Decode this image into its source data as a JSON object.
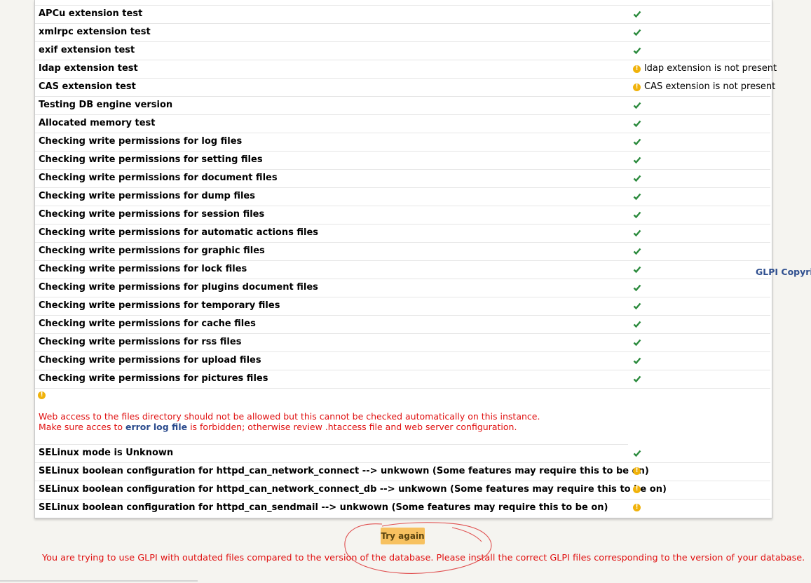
{
  "checks": [
    {
      "label": "APCu extension test",
      "status": "ok"
    },
    {
      "label": "xmlrpc extension test",
      "status": "ok"
    },
    {
      "label": "exif extension test",
      "status": "ok"
    },
    {
      "label": "ldap extension test",
      "status": "warning",
      "message": "ldap extension is not present"
    },
    {
      "label": "CAS extension test",
      "status": "warning",
      "message": "CAS extension is not present"
    },
    {
      "label": "Testing DB engine version",
      "status": "ok"
    },
    {
      "label": "Allocated memory test",
      "status": "ok"
    },
    {
      "label": "Checking write permissions for log files",
      "status": "ok"
    },
    {
      "label": "Checking write permissions for setting files",
      "status": "ok"
    },
    {
      "label": "Checking write permissions for document files",
      "status": "ok"
    },
    {
      "label": "Checking write permissions for dump files",
      "status": "ok"
    },
    {
      "label": "Checking write permissions for session files",
      "status": "ok"
    },
    {
      "label": "Checking write permissions for automatic actions files",
      "status": "ok"
    },
    {
      "label": "Checking write permissions for graphic files",
      "status": "ok"
    },
    {
      "label": "Checking write permissions for lock files",
      "status": "ok"
    },
    {
      "label": "Checking write permissions for plugins document files",
      "status": "ok"
    },
    {
      "label": "Checking write permissions for temporary files",
      "status": "ok"
    },
    {
      "label": "Checking write permissions for cache files",
      "status": "ok"
    },
    {
      "label": "Checking write permissions for rss files",
      "status": "ok"
    },
    {
      "label": "Checking write permissions for upload files",
      "status": "ok"
    },
    {
      "label": "Checking write permissions for pictures files",
      "status": "ok"
    }
  ],
  "web_access": {
    "line1": "Web access to the files directory should not be allowed but this cannot be checked automatically on this instance.",
    "line2_pre": "Make sure acces to ",
    "line2_link": "error log file",
    "line2_post": " is forbidden; otherwise review .htaccess file and web server configuration."
  },
  "selinux_checks": [
    {
      "label": "SELinux mode is Unknown",
      "status": "ok"
    },
    {
      "label": "SELinux boolean configuration for httpd_can_network_connect --> unkwown (Some features may require this to be on)",
      "status": "warning"
    },
    {
      "label": "SELinux boolean configuration for httpd_can_network_connect_db --> unkwown (Some features may require this to be on)",
      "status": "warning"
    },
    {
      "label": "SELinux boolean configuration for httpd_can_sendmail --> unkwown (Some features may require this to be on)",
      "status": "warning"
    }
  ],
  "side_text": "GLPI Copyri",
  "try_again_label": "Try again",
  "outdated_message": "You are trying to use GLPI with outdated files compared to the version of the database. Please install the correct GLPI files corresponding to the version of your database.",
  "colors": {
    "ok": "#2a8a3c",
    "warning": "#f0b20a",
    "error_text": "#e01010",
    "button": "#f7c160"
  }
}
